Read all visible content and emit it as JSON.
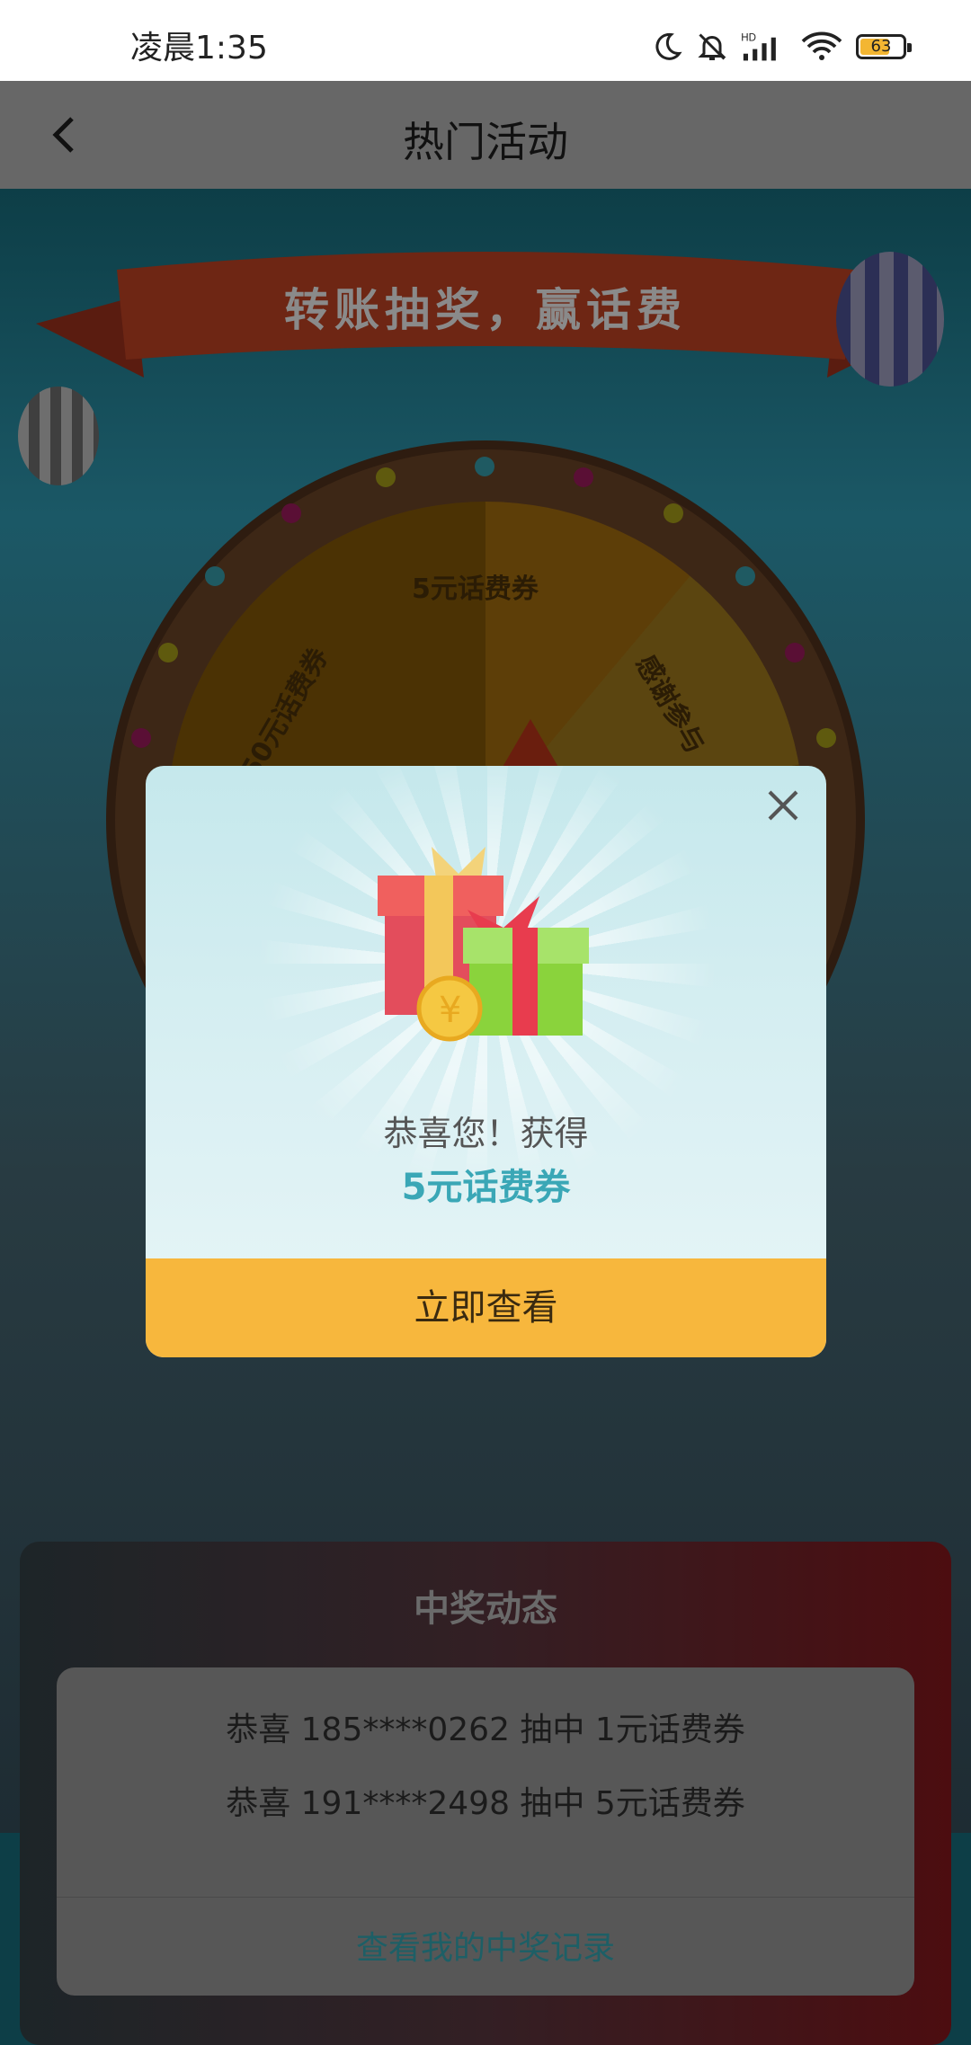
{
  "status_bar": {
    "time": "凌晨1:35",
    "battery": "63",
    "icons": [
      "moon-icon",
      "bell-off-icon",
      "hd-signal-icon",
      "wifi-icon",
      "battery-icon"
    ]
  },
  "nav": {
    "title": "热门活动",
    "back_icon": "back-arrow-icon"
  },
  "game": {
    "banner": "转账抽奖，赢话费",
    "wheel_labels": [
      "5元话费券",
      "50元话费券",
      "感谢参与"
    ]
  },
  "modal": {
    "congrats": "恭喜您！获得",
    "prize": "5元话费券",
    "button": "立即查看",
    "close_icon": "close-icon",
    "gift_icon": "gift-box-icon"
  },
  "winners": {
    "title": "中奖动态",
    "lines": [
      "恭喜 185****0262 抽中 1元话费券",
      "恭喜 191****2498 抽中 5元话费券"
    ],
    "link": "查看我的中奖记录"
  },
  "colors": {
    "accent_button": "#f7b73d",
    "prize_text": "#3aa7b6"
  }
}
